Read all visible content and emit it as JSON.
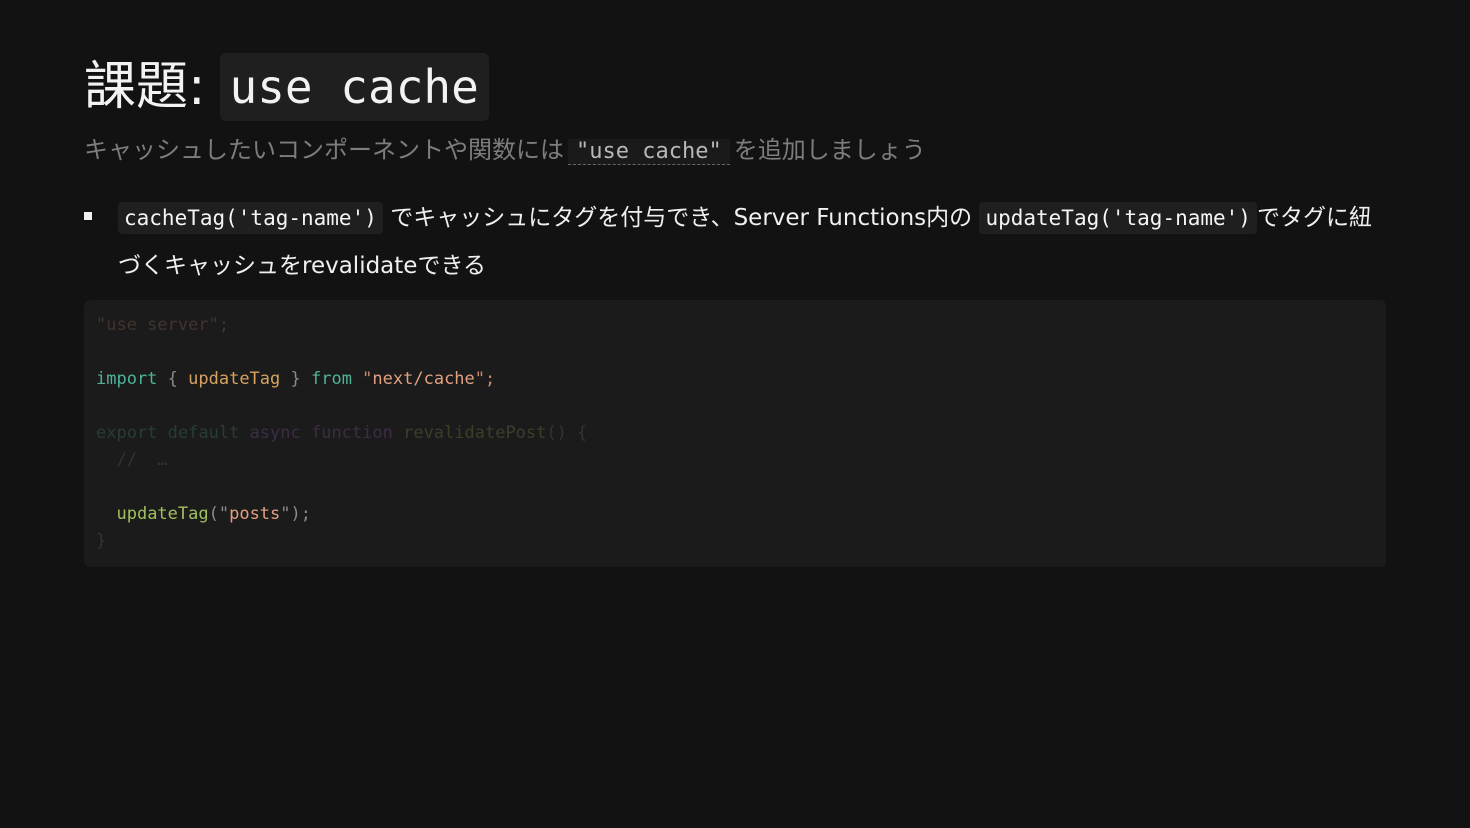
{
  "title": {
    "prefix": "課題:",
    "code": "use cache"
  },
  "subtitle": {
    "before": "キャッシュしたいコンポーネントや関数には",
    "code": "\"use cache\"",
    "after": "を追加しましょう"
  },
  "bullet": {
    "code1": "cacheTag('tag-name')",
    "text1": "でキャッシュにタグを付与でき、Server Functions内の",
    "code2": "updateTag('tag-name')",
    "text2": "でタグに紐づくキャッシュをrevalidateできる"
  },
  "code": {
    "line1": "\"use server\";",
    "line3_import": "import",
    "line3_open": " { ",
    "line3_name": "updateTag",
    "line3_close": " } ",
    "line3_from": "from",
    "line3_q1": " \"",
    "line3_mod": "next/cache",
    "line3_q2": "\";",
    "line5_export": "export",
    "line5_default": " default",
    "line5_async": " async",
    "line5_function": " function",
    "line5_name": " revalidatePost",
    "line5_tail": "() {",
    "line6": "  //  …",
    "line8_fn": "updateTag",
    "line8_open": "(\"",
    "line8_arg": "posts",
    "line8_close": "\");",
    "line9": "}"
  }
}
